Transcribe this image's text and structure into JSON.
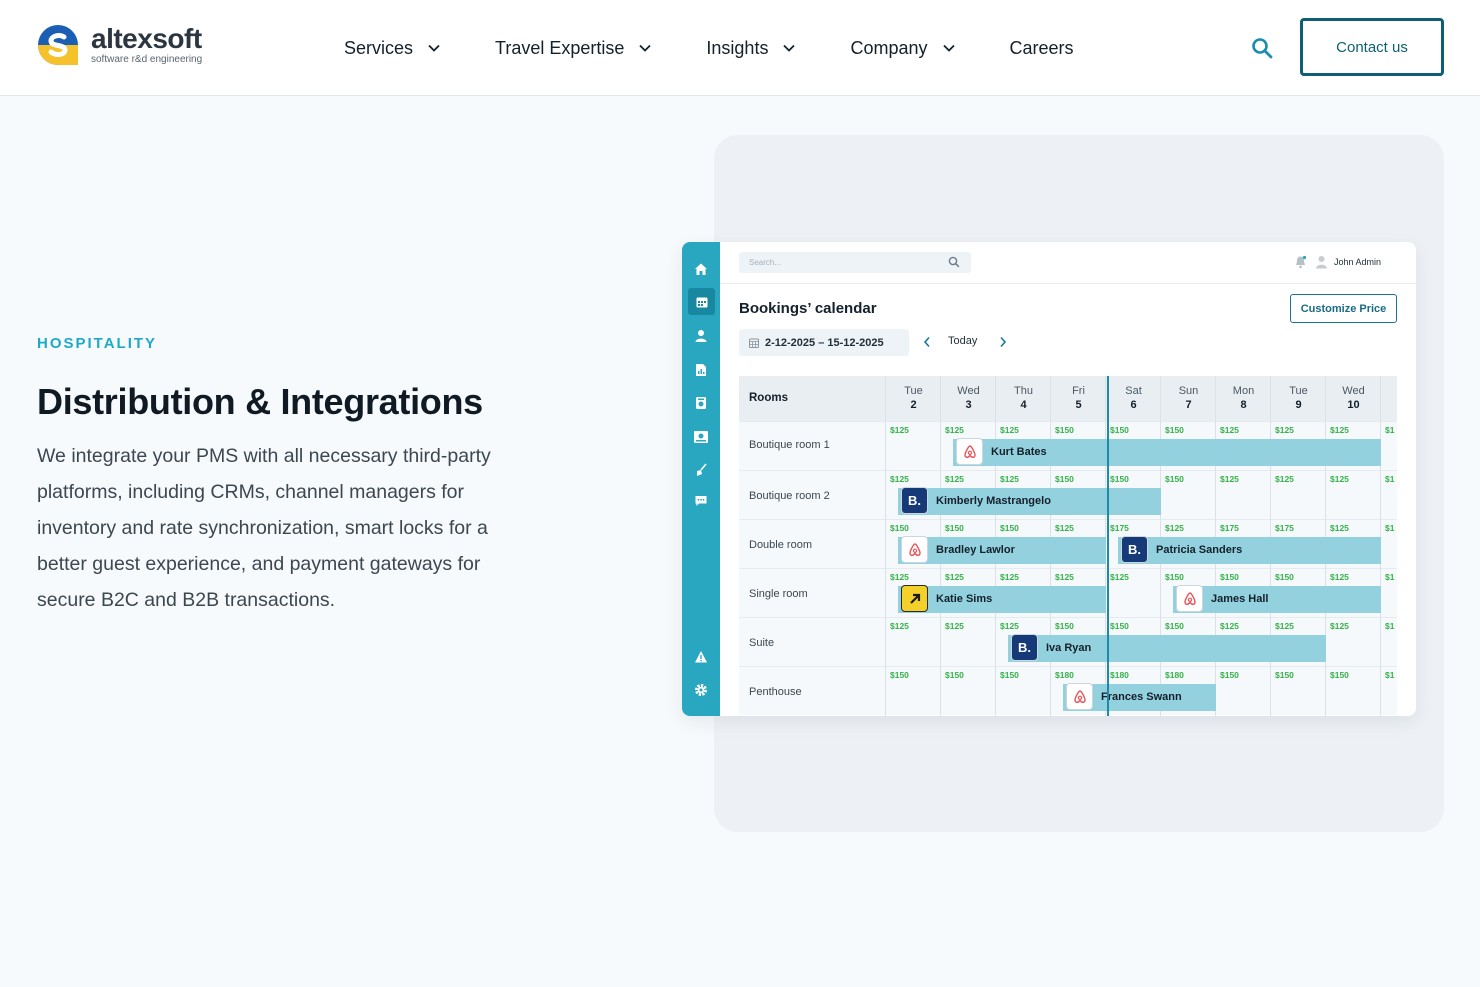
{
  "nav": {
    "logo_name": "altexsoft",
    "logo_tagline": "software r&d engineering",
    "items": [
      {
        "label": "Services",
        "has_dropdown": true
      },
      {
        "label": "Travel Expertise",
        "has_dropdown": true
      },
      {
        "label": "Insights",
        "has_dropdown": true
      },
      {
        "label": "Company",
        "has_dropdown": true
      },
      {
        "label": "Careers",
        "has_dropdown": false
      }
    ],
    "contact_label": "Contact us"
  },
  "hero": {
    "eyebrow": "HOSPITALITY",
    "title": "Distribution & Integrations",
    "body": "We integrate your PMS with all necessary third-party platforms, including CRMs, channel managers for inventory and rate synchronization, smart locks for a better guest experience, and payment gateways for secure B2C and B2B transactions."
  },
  "app": {
    "search_placeholder": "Search...",
    "user_name": "John Admin",
    "title": "Bookings’ calendar",
    "customize_label": "Customize Price",
    "date_range": "2-12-2025 – 15-12-2025",
    "today_label": "Today",
    "rooms_header": "Rooms",
    "days": [
      {
        "dow": "Tue",
        "num": "2"
      },
      {
        "dow": "Wed",
        "num": "3"
      },
      {
        "dow": "Thu",
        "num": "4"
      },
      {
        "dow": "Fri",
        "num": "5"
      },
      {
        "dow": "Sat",
        "num": "6"
      },
      {
        "dow": "Sun",
        "num": "7"
      },
      {
        "dow": "Mon",
        "num": "8"
      },
      {
        "dow": "Tue",
        "num": "9"
      },
      {
        "dow": "Wed",
        "num": "10"
      }
    ],
    "rooms": [
      {
        "name": "Boutique room 1",
        "prices": [
          "$125",
          "$125",
          "$125",
          "$150",
          "$150",
          "$150",
          "$125",
          "$125",
          "$125",
          "$1"
        ]
      },
      {
        "name": "Boutique room 2",
        "prices": [
          "$125",
          "$125",
          "$125",
          "$150",
          "$150",
          "$150",
          "$125",
          "$125",
          "$125",
          "$1"
        ]
      },
      {
        "name": "Double room",
        "prices": [
          "$150",
          "$150",
          "$150",
          "$125",
          "$175",
          "$125",
          "$175",
          "$175",
          "$125",
          "$1"
        ]
      },
      {
        "name": "Single room",
        "prices": [
          "$125",
          "$125",
          "$125",
          "$125",
          "$125",
          "$150",
          "$150",
          "$150",
          "$125",
          "$1"
        ]
      },
      {
        "name": "Suite",
        "prices": [
          "$125",
          "$125",
          "$125",
          "$150",
          "$150",
          "$150",
          "$125",
          "$125",
          "$125",
          "$1"
        ]
      },
      {
        "name": "Penthouse",
        "prices": [
          "$150",
          "$150",
          "$150",
          "$180",
          "$180",
          "$180",
          "$150",
          "$150",
          "$150",
          "$1"
        ]
      }
    ],
    "bookings": [
      {
        "guest": "Kurt Bates",
        "room": 0,
        "start": 1,
        "end": 9,
        "source": "airbnb"
      },
      {
        "guest": "Kimberly Mastrangelo",
        "room": 1,
        "start": 0,
        "end": 5,
        "source": "booking-com"
      },
      {
        "guest": "Bradley Lawlor",
        "room": 2,
        "start": 0,
        "end": 4,
        "source": "airbnb"
      },
      {
        "guest": "Patricia Sanders",
        "room": 2,
        "start": 4,
        "end": 9,
        "source": "booking-com"
      },
      {
        "guest": "Katie Sims",
        "room": 3,
        "start": 0,
        "end": 4,
        "source": "arrow"
      },
      {
        "guest": "James Hall",
        "room": 3,
        "start": 5,
        "end": 9,
        "source": "airbnb"
      },
      {
        "guest": "Iva Ryan",
        "room": 4,
        "start": 2,
        "end": 8,
        "source": "booking-com"
      },
      {
        "guest": "Frances Swann",
        "room": 5,
        "start": 3,
        "end": 6,
        "source": "airbnb"
      }
    ],
    "sidebar_icons": [
      "home-icon",
      "calendar-icon",
      "user-icon",
      "report-icon",
      "printer-icon",
      "reception-icon",
      "broom-icon",
      "chat-icon",
      "alert-icon",
      "settings-icon"
    ]
  },
  "colors": {
    "accent": "#1fa9c9",
    "brand_dark": "#0e5f74",
    "sidebar": "#2aa7c0",
    "booking_bar": "#93d1de",
    "price_green": "#35b24a"
  }
}
